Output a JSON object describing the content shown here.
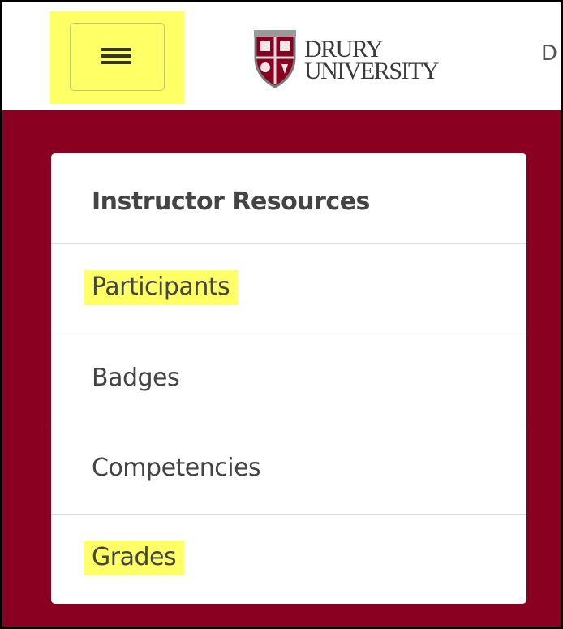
{
  "navbar": {
    "menu_icon": "hamburger-icon",
    "logo": {
      "line1": "DRURY",
      "line2": "UNIVERSITY",
      "icon": "crest-icon"
    },
    "partial_text": "D"
  },
  "resources": {
    "title": "Instructor Resources",
    "items": [
      {
        "label": "Participants",
        "highlighted": true
      },
      {
        "label": "Badges",
        "highlighted": false
      },
      {
        "label": "Competencies",
        "highlighted": false
      },
      {
        "label": "Grades",
        "highlighted": true
      }
    ]
  },
  "colors": {
    "brand": "#8a0021",
    "highlight": "#ffff66",
    "text": "#444444"
  }
}
